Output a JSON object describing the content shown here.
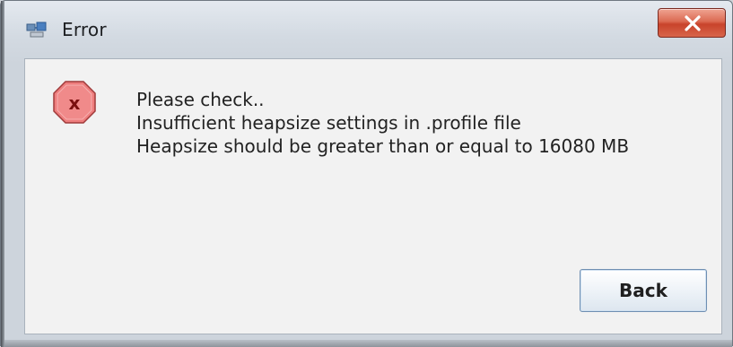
{
  "window": {
    "title": "Error",
    "icons": {
      "app": "java-app-icon",
      "close": "close-icon",
      "error": "error-icon"
    },
    "colors": {
      "close_button": "#d9573f",
      "error_icon": "#e66a6a",
      "content_background": "#f2f2f2"
    }
  },
  "dialog": {
    "message_lines": [
      "Please check..",
      "Insufficient heapsize settings in .profile file",
      "Heapsize should be greater than or equal to 16080 MB"
    ],
    "back_button_label": "Back"
  }
}
